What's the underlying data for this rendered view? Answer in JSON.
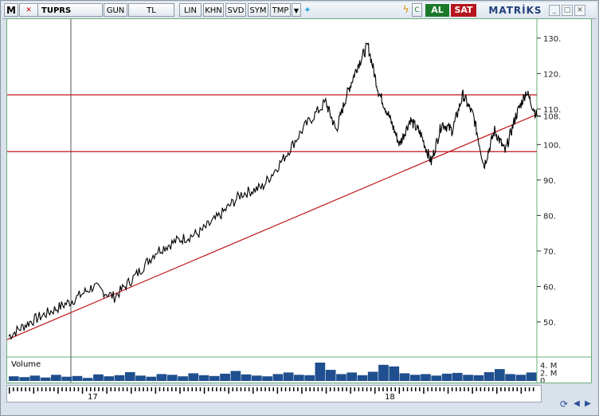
{
  "toolbar": {
    "menu_button": "M",
    "symbol": "TUPRS",
    "buttons": [
      "GUN",
      "TL",
      "LIN",
      "KHN",
      "SVD",
      "SYM",
      "TMP"
    ],
    "buy_label": "AL",
    "sell_label": "SAT",
    "brand": "MATRİKS"
  },
  "chart_data": {
    "type": "line",
    "title": "",
    "y_axis_labels": [
      "130.",
      "120.",
      "110.",
      "108.",
      "100.",
      "90.",
      "80.",
      "70.",
      "60.",
      "50."
    ],
    "y_ticks": [
      130,
      120,
      110,
      100,
      90,
      80,
      70,
      60,
      50
    ],
    "ylim": [
      41,
      134
    ],
    "current_price_label": "108.",
    "current_price": 108,
    "x_date_labels": [
      "17",
      "18"
    ],
    "price_series": {
      "name": "",
      "x": [
        0,
        0.04,
        0.08,
        0.12,
        0.16,
        0.2,
        0.24,
        0.28,
        0.32,
        0.36,
        0.4,
        0.44,
        0.48,
        0.52,
        0.56,
        0.6,
        0.62,
        0.64,
        0.66,
        0.68,
        0.7,
        0.72,
        0.74,
        0.76,
        0.78,
        0.8,
        0.82,
        0.84,
        0.86,
        0.88,
        0.9,
        0.92,
        0.94,
        0.96,
        0.98,
        1.0
      ],
      "values": [
        46,
        50,
        53,
        56,
        60,
        57,
        63,
        70,
        73,
        75,
        80,
        86,
        88,
        96,
        105,
        112,
        104,
        114,
        122,
        128,
        115,
        108,
        100,
        107,
        103,
        95,
        106,
        104,
        114,
        108,
        94,
        104,
        98,
        108,
        115,
        108
      ]
    },
    "resistance_levels": [
      114,
      98
    ],
    "trendline": {
      "from_value": 45,
      "to_value": 108.5
    },
    "vertical_marker_label": "",
    "volume": {
      "label": "Volume",
      "axis_labels": [
        "4. M",
        "2. M",
        "0"
      ],
      "values": [
        1.2,
        1.0,
        1.4,
        0.9,
        1.6,
        1.1,
        1.3,
        0.8,
        1.7,
        1.2,
        1.5,
        2.3,
        1.4,
        1.1,
        1.8,
        1.6,
        1.2,
        2.0,
        1.5,
        1.3,
        1.9,
        2.6,
        1.7,
        1.4,
        1.2,
        1.8,
        2.2,
        1.6,
        1.5,
        4.8,
        2.9,
        1.8,
        2.2,
        1.5,
        2.4,
        4.2,
        3.8,
        2.0,
        1.6,
        1.8,
        1.4,
        1.9,
        2.1,
        1.6,
        1.5,
        2.3,
        3.1,
        1.8,
        1.6,
        2.2
      ]
    }
  },
  "colors": {
    "price_line": "#000000",
    "levels": "#c0161b",
    "volume": "#1f4f8e",
    "frame": "#6ab07a"
  }
}
